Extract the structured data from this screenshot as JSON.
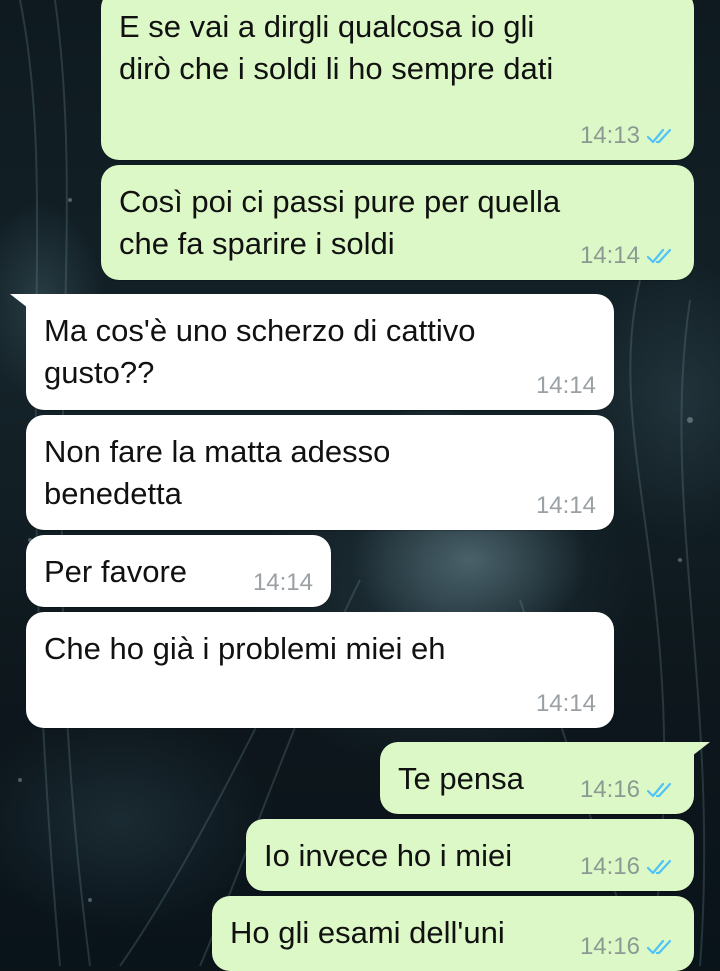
{
  "messages": [
    {
      "direction": "out",
      "text": "E se vai a dirgli qualcosa io gli\ndirò che i soldi li ho sempre dati",
      "time": "14:13",
      "read": true
    },
    {
      "direction": "out",
      "text": "Così poi ci passi pure per quella\nche fa sparire i soldi",
      "time": "14:14",
      "read": true
    },
    {
      "direction": "in",
      "text": "Ma cos'è uno scherzo di cattivo\ngusto??",
      "time": "14:14"
    },
    {
      "direction": "in",
      "text": "Non fare la matta adesso\nbenedetta",
      "time": "14:14"
    },
    {
      "direction": "in",
      "text": "Per favore",
      "time": "14:14"
    },
    {
      "direction": "in",
      "text": "Che ho già i problemi miei eh",
      "time": "14:14"
    },
    {
      "direction": "out",
      "text": "Te pensa",
      "time": "14:16",
      "read": true
    },
    {
      "direction": "out",
      "text": "Io invece ho i miei",
      "time": "14:16",
      "read": true
    },
    {
      "direction": "out",
      "text": "Ho gli esami dell'uni",
      "time": "14:16",
      "read": true
    }
  ],
  "colors": {
    "outgoing_bubble": "#dcf8c6",
    "incoming_bubble": "#ffffff",
    "read_check": "#4fc3f7",
    "timestamp": "#8c9a93"
  },
  "icons": {
    "read_receipt": "double-check-icon"
  }
}
